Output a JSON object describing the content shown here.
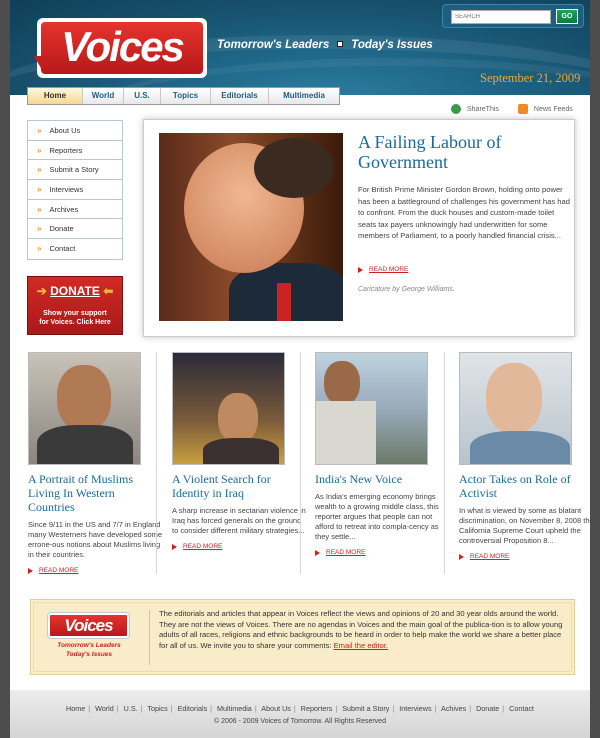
{
  "header": {
    "logo_text": "Voices",
    "tagline_left": "Tomorrow's Leaders",
    "tagline_right": "Today's Issues",
    "search_placeholder": "SEARCH",
    "go_label": "GO",
    "date": "September 21, 2009"
  },
  "nav": {
    "items": [
      "Home",
      "World",
      "U.S.",
      "Topics",
      "Editorials",
      "Multimedia"
    ],
    "active": "Home"
  },
  "share": {
    "share_label": "ShareThis",
    "news_label": "News Feeds"
  },
  "sidebar": {
    "items": [
      "About Us",
      "Reporters",
      "Submit a Story",
      "Interviews",
      "Archives",
      "Donate",
      "Contact"
    ]
  },
  "donate": {
    "title": "DONATE",
    "text_line1": "Show your support",
    "text_line2": "for Voices. Click Here"
  },
  "feature": {
    "title": "A Failing Labour of Government",
    "body": "For British Prime Minister Gordon Brown, holding onto power has been a battleground of challenges his government has had to confront. From the duck houses and custom-made toilet seats tax payers unknowingly had underwritten for some members of Parliament, to a poorly handled financial crisis...",
    "read_more": "READ MORE",
    "caption": "Caricature by George Williams."
  },
  "stories": [
    {
      "title": "A Portrait of Muslims Living In Western Countries",
      "body": "Since 9/11 in the US and 7/7 in England many Westerners have developed some errone-ous notions about Muslims living in their countries.",
      "read_more": "READ MORE"
    },
    {
      "title": "A Violent Search for Identity in Iraq",
      "body": "A sharp increase in sectarian violence in Iraq has forced generals on the ground to consider different military strategies...",
      "read_more": "READ MORE"
    },
    {
      "title": "India's New Voice",
      "body": "As India's emerging economy brings wealth to a growing middle class, this reporter argues that people can not afford to retreat into compla-cency as they settle...",
      "read_more": "READ MORE"
    },
    {
      "title": "Actor Takes on Role of Activist",
      "body": "In what is viewed by some as blatant discrimination, on November 8, 2008 the California Supreme Court upheld the controversial Proposition 8...",
      "read_more": "READ MORE"
    }
  ],
  "footer_box": {
    "logo_text": "Voices",
    "tagline_line1": "Tomorrow's Leaders",
    "tagline_line2": "Today's Issues",
    "text": "The editorials and articles that appear in Voices reflect the views and opinions of 20 and 30 year olds around the world. They are not the views of Voices. There are no agendas in Voices and the main goal of the publica-tion is to allow young adults of all races, religions and ethnic backgrounds to be heard in order to help make the world we share a better place for all of us. We invite you to share your comments: ",
    "link": "Email the editor."
  },
  "footer": {
    "links": [
      "Home",
      "World",
      "U.S.",
      "Topics",
      "Editorials",
      "Multimedia",
      "About Us",
      "Reporters",
      "Submit a Story",
      "Interviews",
      "Achives",
      "Donate",
      "Contact"
    ],
    "copyright": "© 2006 - 2009 Voices of Tomorrow. All Rights Reserved"
  },
  "colors": {
    "brand_red": "#c41f1f",
    "link_blue": "#1a6a9b",
    "header_blue": "#164f6c",
    "date_orange": "#f0a830"
  }
}
